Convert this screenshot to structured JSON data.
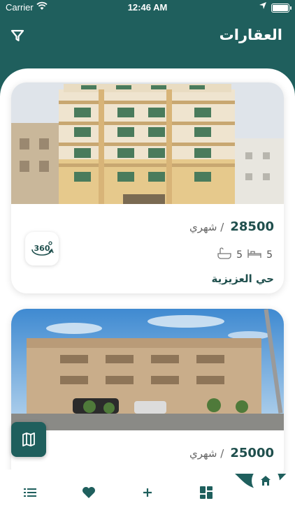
{
  "status_bar": {
    "carrier": "Carrier",
    "time": "12:46 AM"
  },
  "header": {
    "title": "العقارات",
    "filter_icon": "filter-icon"
  },
  "listings": [
    {
      "price": "28500",
      "period": "/ شهري",
      "bedrooms": "5",
      "bathrooms": "5",
      "district": "حي العزيزية",
      "badge": "360"
    },
    {
      "price": "25000",
      "period": "/ شهري"
    }
  ],
  "tabbar": {
    "items": [
      "list-icon",
      "heart-icon",
      "plus-icon",
      "dashboard-icon",
      "home-icon"
    ]
  },
  "colors": {
    "primary": "#1f5f5d",
    "text_dark": "#1f4f4d"
  }
}
